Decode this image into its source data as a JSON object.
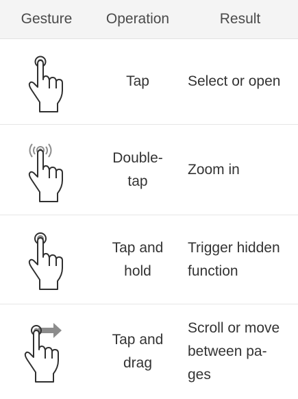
{
  "header": {
    "gesture": "Gesture",
    "operation": "Operation",
    "result": "Result"
  },
  "rows": [
    {
      "gesture_icon": "tap-hand-icon",
      "operation": "Tap",
      "result": "Select or open"
    },
    {
      "gesture_icon": "double-tap-hand-icon",
      "operation": "Double-\ntap",
      "result": "Zoom in"
    },
    {
      "gesture_icon": "tap-and-hold-hand-icon",
      "operation": "Tap and\nhold",
      "result": "Trigger hidden\nfunction"
    },
    {
      "gesture_icon": "tap-and-drag-hand-icon",
      "operation": "Tap and\ndrag",
      "result": "Scroll or move\nbetween pa-\nges"
    }
  ],
  "colors": {
    "header_bg": "#f4f4f4",
    "text": "#333333",
    "icon_outline": "#2f2f2f",
    "icon_accent_gray": "#8c8c8c"
  }
}
